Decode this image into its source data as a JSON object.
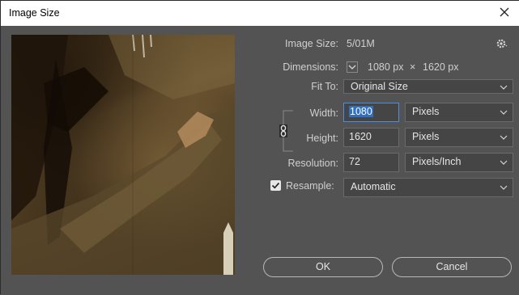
{
  "window": {
    "title": "Image Size"
  },
  "info": {
    "image_size_label": "Image Size:",
    "image_size_value": "5/01M",
    "dimensions_label": "Dimensions:",
    "dim_width": "1080 px",
    "dim_times": "×",
    "dim_height": "1620 px"
  },
  "fit_to": {
    "label": "Fit To:",
    "value": "Original Size"
  },
  "width": {
    "label": "Width:",
    "value": "1080",
    "unit": "Pixels"
  },
  "height": {
    "label": "Height:",
    "value": "1620",
    "unit": "Pixels"
  },
  "resolution": {
    "label": "Resolution:",
    "value": "72",
    "unit": "Pixels/Inch"
  },
  "resample": {
    "label": "Resample:",
    "checked": true,
    "value": "Automatic"
  },
  "buttons": {
    "ok": "OK",
    "cancel": "Cancel"
  },
  "icons": {
    "close": "close-icon",
    "gear": "gear-icon",
    "chevron": "chevron-down-icon",
    "link": "chain-link-icon",
    "checkmark": "checkmark-icon"
  },
  "colors": {
    "accent": "#4a90e2",
    "panel": "#535353",
    "field": "#454545"
  }
}
